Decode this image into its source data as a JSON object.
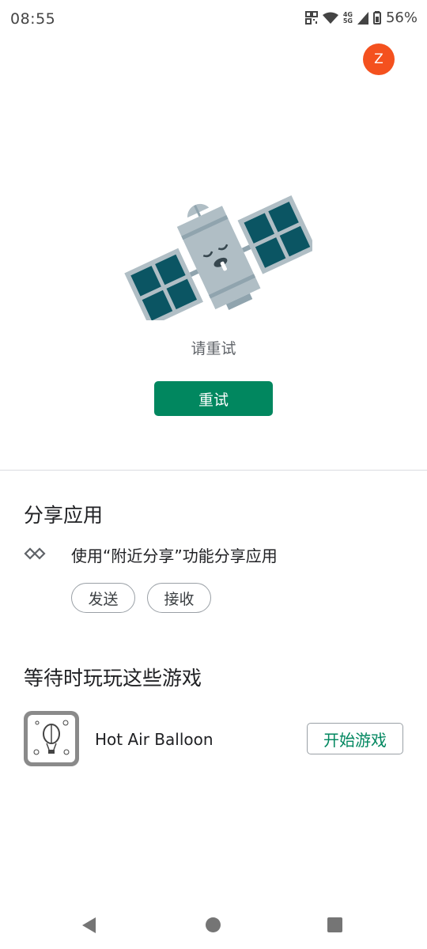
{
  "status_bar": {
    "time": "08:55",
    "network_top": "4G",
    "network_bottom": "5G",
    "battery": "56%",
    "icons": [
      "qr-icon",
      "wifi-icon",
      "signal-icon",
      "battery-icon"
    ]
  },
  "account": {
    "avatar_letter": "Z",
    "avatar_color": "#f4511e"
  },
  "error": {
    "illustration": "sleeping-satellite",
    "message": "请重试",
    "retry_label": "重试",
    "accent_color": "#01875f"
  },
  "share": {
    "title": "分享应用",
    "icon": "nearby-share-icon",
    "description": "使用“附近分享”功能分享应用",
    "send_label": "发送",
    "receive_label": "接收"
  },
  "games": {
    "title": "等待时玩玩这些游戏",
    "items": [
      {
        "name": "Hot Air Balloon",
        "icon": "hot-air-balloon-icon",
        "play_label": "开始游戏"
      }
    ]
  },
  "nav_bar": {
    "icons": [
      "back-icon",
      "home-icon",
      "recents-icon"
    ]
  }
}
